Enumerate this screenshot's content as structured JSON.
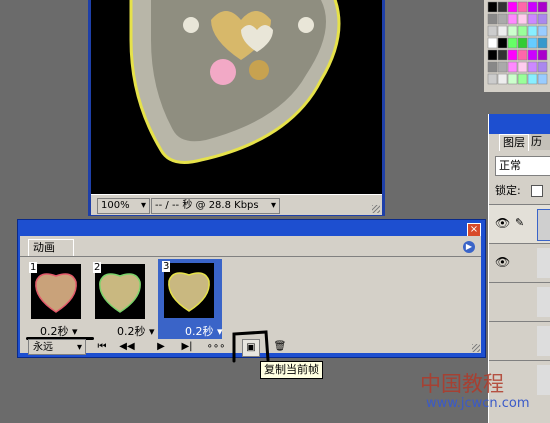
{
  "document": {
    "zoom": "100%",
    "download_info": "-- / -- 秒 @ 28.8 Kbps"
  },
  "layers_panel": {
    "tabs": [
      "图层",
      "历"
    ],
    "blend_mode": "正常",
    "lock_label": "锁定:"
  },
  "animation_panel": {
    "title": "动画",
    "frames": [
      {
        "number": "1",
        "delay": "0.2秒",
        "selected": false
      },
      {
        "number": "2",
        "delay": "0.2秒",
        "selected": false
      },
      {
        "number": "3",
        "delay": "0.2秒",
        "selected": true
      }
    ],
    "loop_option": "永远",
    "tooltip": "复制当前帧"
  },
  "watermark": {
    "text": "中国教程",
    "url": "www.jcwcn.com"
  },
  "colors": {
    "selection": "#3a64c8",
    "panel_bg": "#d4d0c8",
    "title_blue": "#1d4fd0"
  }
}
